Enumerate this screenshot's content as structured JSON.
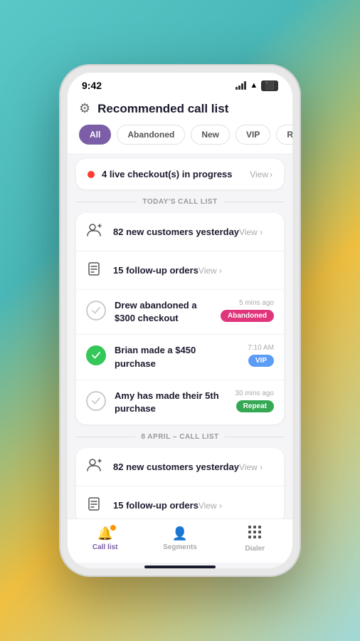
{
  "statusBar": {
    "time": "9:42"
  },
  "header": {
    "title": "Recommended call list"
  },
  "filters": [
    {
      "label": "All",
      "active": true
    },
    {
      "label": "Abandoned",
      "active": false
    },
    {
      "label": "New",
      "active": false
    },
    {
      "label": "VIP",
      "active": false
    },
    {
      "label": "Repeat",
      "active": false
    }
  ],
  "liveBanner": {
    "text": "4 live checkout(s) in progress",
    "viewLabel": "View"
  },
  "todaySection": {
    "label": "TODAY'S CALL LIST",
    "rows": [
      {
        "icon": "👤+",
        "title": "82 new customers yesterday",
        "viewLabel": "View"
      },
      {
        "icon": "📋",
        "title": "15 follow-up orders",
        "viewLabel": "View"
      }
    ],
    "callItems": [
      {
        "checked": false,
        "name": "Drew abandoned a $300 checkout",
        "time": "5 mins ago",
        "badge": "Abandoned",
        "badgeClass": "badge-abandoned"
      },
      {
        "checked": true,
        "name": "Brian made a $450 purchase",
        "time": "7:10 AM",
        "badge": "VIP",
        "badgeClass": "badge-vip"
      },
      {
        "checked": false,
        "name": "Amy has made their 5th purchase",
        "time": "30 mins ago",
        "badge": "Repeat",
        "badgeClass": "badge-repeat"
      }
    ]
  },
  "aprilSection": {
    "label": "8 APRIL – CALL LIST",
    "rows": [
      {
        "icon": "👤+",
        "title": "82 new customers yesterday",
        "viewLabel": "View"
      },
      {
        "icon": "📋",
        "title": "15 follow-up orders",
        "viewLabel": "View"
      }
    ]
  },
  "bottomNav": [
    {
      "label": "Call list",
      "active": true,
      "icon": "🔔",
      "hasNotification": true
    },
    {
      "label": "Segments",
      "active": false,
      "icon": "👤",
      "hasNotification": false
    },
    {
      "label": "Dialer",
      "active": false,
      "icon": "⌨",
      "hasNotification": false
    }
  ]
}
